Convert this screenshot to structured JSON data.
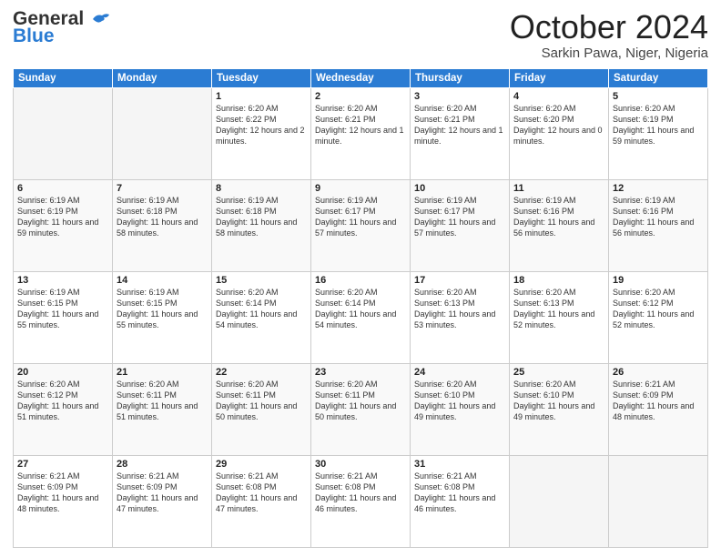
{
  "header": {
    "logo_general": "General",
    "logo_blue": "Blue",
    "month_title": "October 2024",
    "location": "Sarkin Pawa, Niger, Nigeria"
  },
  "weekdays": [
    "Sunday",
    "Monday",
    "Tuesday",
    "Wednesday",
    "Thursday",
    "Friday",
    "Saturday"
  ],
  "weeks": [
    [
      {
        "day": "",
        "empty": true
      },
      {
        "day": "",
        "empty": true
      },
      {
        "day": "1",
        "sunrise": "6:20 AM",
        "sunset": "6:22 PM",
        "daylight": "12 hours and 2 minutes."
      },
      {
        "day": "2",
        "sunrise": "6:20 AM",
        "sunset": "6:21 PM",
        "daylight": "12 hours and 1 minute."
      },
      {
        "day": "3",
        "sunrise": "6:20 AM",
        "sunset": "6:21 PM",
        "daylight": "12 hours and 1 minute."
      },
      {
        "day": "4",
        "sunrise": "6:20 AM",
        "sunset": "6:20 PM",
        "daylight": "12 hours and 0 minutes."
      },
      {
        "day": "5",
        "sunrise": "6:20 AM",
        "sunset": "6:19 PM",
        "daylight": "11 hours and 59 minutes."
      }
    ],
    [
      {
        "day": "6",
        "sunrise": "6:19 AM",
        "sunset": "6:19 PM",
        "daylight": "11 hours and 59 minutes."
      },
      {
        "day": "7",
        "sunrise": "6:19 AM",
        "sunset": "6:18 PM",
        "daylight": "11 hours and 58 minutes."
      },
      {
        "day": "8",
        "sunrise": "6:19 AM",
        "sunset": "6:18 PM",
        "daylight": "11 hours and 58 minutes."
      },
      {
        "day": "9",
        "sunrise": "6:19 AM",
        "sunset": "6:17 PM",
        "daylight": "11 hours and 57 minutes."
      },
      {
        "day": "10",
        "sunrise": "6:19 AM",
        "sunset": "6:17 PM",
        "daylight": "11 hours and 57 minutes."
      },
      {
        "day": "11",
        "sunrise": "6:19 AM",
        "sunset": "6:16 PM",
        "daylight": "11 hours and 56 minutes."
      },
      {
        "day": "12",
        "sunrise": "6:19 AM",
        "sunset": "6:16 PM",
        "daylight": "11 hours and 56 minutes."
      }
    ],
    [
      {
        "day": "13",
        "sunrise": "6:19 AM",
        "sunset": "6:15 PM",
        "daylight": "11 hours and 55 minutes."
      },
      {
        "day": "14",
        "sunrise": "6:19 AM",
        "sunset": "6:15 PM",
        "daylight": "11 hours and 55 minutes."
      },
      {
        "day": "15",
        "sunrise": "6:20 AM",
        "sunset": "6:14 PM",
        "daylight": "11 hours and 54 minutes."
      },
      {
        "day": "16",
        "sunrise": "6:20 AM",
        "sunset": "6:14 PM",
        "daylight": "11 hours and 54 minutes."
      },
      {
        "day": "17",
        "sunrise": "6:20 AM",
        "sunset": "6:13 PM",
        "daylight": "11 hours and 53 minutes."
      },
      {
        "day": "18",
        "sunrise": "6:20 AM",
        "sunset": "6:13 PM",
        "daylight": "11 hours and 52 minutes."
      },
      {
        "day": "19",
        "sunrise": "6:20 AM",
        "sunset": "6:12 PM",
        "daylight": "11 hours and 52 minutes."
      }
    ],
    [
      {
        "day": "20",
        "sunrise": "6:20 AM",
        "sunset": "6:12 PM",
        "daylight": "11 hours and 51 minutes."
      },
      {
        "day": "21",
        "sunrise": "6:20 AM",
        "sunset": "6:11 PM",
        "daylight": "11 hours and 51 minutes."
      },
      {
        "day": "22",
        "sunrise": "6:20 AM",
        "sunset": "6:11 PM",
        "daylight": "11 hours and 50 minutes."
      },
      {
        "day": "23",
        "sunrise": "6:20 AM",
        "sunset": "6:11 PM",
        "daylight": "11 hours and 50 minutes."
      },
      {
        "day": "24",
        "sunrise": "6:20 AM",
        "sunset": "6:10 PM",
        "daylight": "11 hours and 49 minutes."
      },
      {
        "day": "25",
        "sunrise": "6:20 AM",
        "sunset": "6:10 PM",
        "daylight": "11 hours and 49 minutes."
      },
      {
        "day": "26",
        "sunrise": "6:21 AM",
        "sunset": "6:09 PM",
        "daylight": "11 hours and 48 minutes."
      }
    ],
    [
      {
        "day": "27",
        "sunrise": "6:21 AM",
        "sunset": "6:09 PM",
        "daylight": "11 hours and 48 minutes."
      },
      {
        "day": "28",
        "sunrise": "6:21 AM",
        "sunset": "6:09 PM",
        "daylight": "11 hours and 47 minutes."
      },
      {
        "day": "29",
        "sunrise": "6:21 AM",
        "sunset": "6:08 PM",
        "daylight": "11 hours and 47 minutes."
      },
      {
        "day": "30",
        "sunrise": "6:21 AM",
        "sunset": "6:08 PM",
        "daylight": "11 hours and 46 minutes."
      },
      {
        "day": "31",
        "sunrise": "6:21 AM",
        "sunset": "6:08 PM",
        "daylight": "11 hours and 46 minutes."
      },
      {
        "day": "",
        "empty": true
      },
      {
        "day": "",
        "empty": true
      }
    ]
  ]
}
